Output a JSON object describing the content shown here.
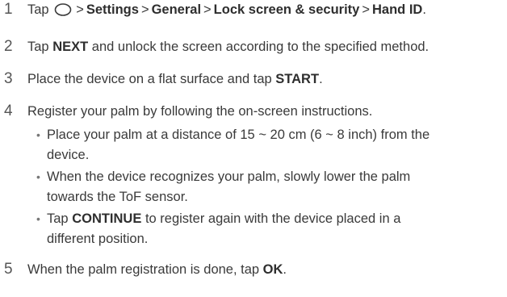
{
  "steps": [
    {
      "num": "1",
      "tap": "Tap",
      "sep1": ">",
      "settings": "Settings",
      "sep2": ">",
      "general": "General",
      "sep3": ">",
      "lock": "Lock screen & security",
      "sep4": ">",
      "hand_id": "Hand ID",
      "end": ".",
      "icon": "home-circle-icon"
    },
    {
      "num": "2",
      "pre": "Tap ",
      "bold": "NEXT",
      "post": " and unlock the screen according to the specified method."
    },
    {
      "num": "3",
      "pre": "Place the device on a flat surface and tap ",
      "bold": "START",
      "post": "."
    },
    {
      "num": "4",
      "text": "Register your palm by following the on-screen instructions.",
      "bullets": [
        {
          "bullet": "•",
          "line1": "Place your palm at a distance of 15 ~ 20 cm (6 ~ 8 inch) from the",
          "line2": "device."
        },
        {
          "bullet": "•",
          "line1": "When the device recognizes your palm, slowly lower the palm",
          "line2": "towards the ToF sensor."
        },
        {
          "bullet": "•",
          "pre": "Tap ",
          "bold": "CONTINUE",
          "post": " to register again with the device placed in a",
          "line2": "different position."
        }
      ]
    },
    {
      "num": "5",
      "pre": "When the palm registration is done, tap ",
      "bold": "OK",
      "post": "."
    }
  ]
}
